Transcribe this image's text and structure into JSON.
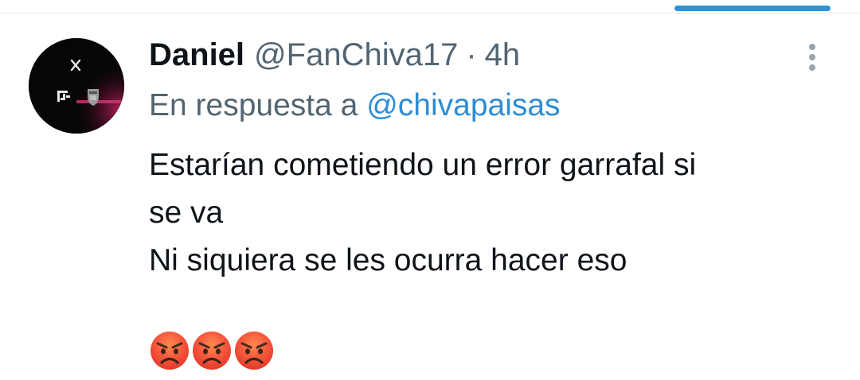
{
  "tweet": {
    "author": {
      "display_name": "Daniel",
      "handle": "@FanChiva17",
      "avatar_icon": "profile-avatar"
    },
    "separator": "·",
    "time": "4h",
    "reply_prefix": "En respuesta a",
    "reply_to": "@chivapaisas",
    "text_lines": [
      "Estarían cometiendo un error garrafal si",
      "se va",
      "Ni siquiera se les ocurra hacer eso"
    ],
    "emojis": [
      "angry-face-icon",
      "angry-face-icon",
      "angry-face-icon"
    ],
    "menu_icon": "more-vertical-icon"
  },
  "colors": {
    "text": "#0f1419",
    "muted": "#536471",
    "mention": "#2e8cd3",
    "scroll_indicator": "#2e93d9"
  }
}
